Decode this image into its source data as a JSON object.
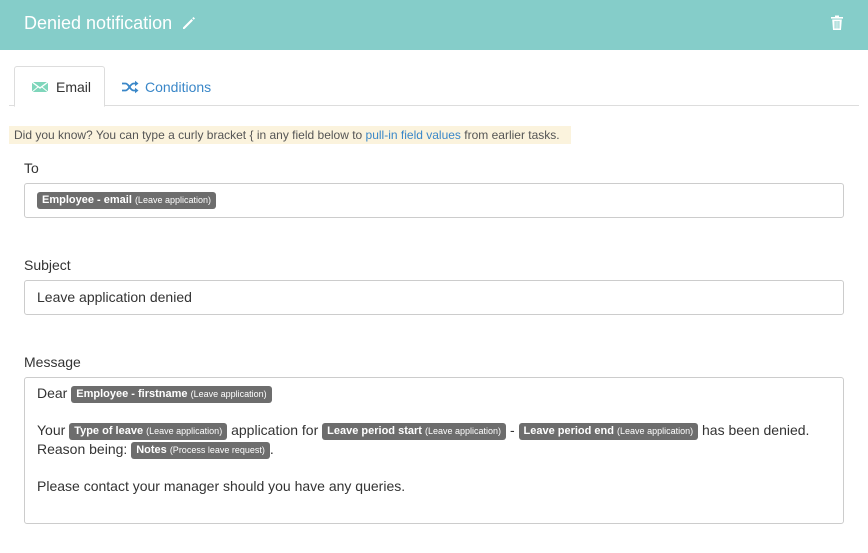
{
  "header": {
    "title": "Denied notification",
    "edit_icon": "pencil-icon",
    "delete_icon": "trash-icon",
    "background": "#85cdc9"
  },
  "tabs": [
    {
      "label": "Email",
      "icon": "envelope-icon",
      "active": true
    },
    {
      "label": "Conditions",
      "icon": "shuffle-icon",
      "active": false
    }
  ],
  "tip": {
    "before": "Did you know? You can type a curly bracket { in any field below to ",
    "link": "pull-in field values",
    "after": " from earlier tasks."
  },
  "to": {
    "label": "To",
    "token": {
      "field": "Employee - email",
      "source": "(Leave application)"
    }
  },
  "subject": {
    "label": "Subject",
    "value": "Leave application denied"
  },
  "message": {
    "label": "Message",
    "greeting": "Dear",
    "greeting_token": {
      "field": "Employee - firstname",
      "source": "(Leave application)"
    },
    "line2_prefix": "Your",
    "type_token": {
      "field": "Type of leave",
      "source": "(Leave application)"
    },
    "line2_mid": "application for",
    "start_token": {
      "field": "Leave period start",
      "source": "(Leave application)"
    },
    "dash": "-",
    "end_token": {
      "field": "Leave period end",
      "source": "(Leave application)"
    },
    "line2_suffix": "has been denied.",
    "line3_prefix": "Reason being:",
    "notes_token": {
      "field": "Notes",
      "source": "(Process leave request)"
    },
    "line3_suffix": ".",
    "closing": "Please contact your manager should you have any queries."
  },
  "colors": {
    "accent": "#85cdc9",
    "link": "#3a87c8",
    "token": "#6d6d6d",
    "tip_bg": "#fbf3dd",
    "email_icon": "#5cc4a8"
  }
}
